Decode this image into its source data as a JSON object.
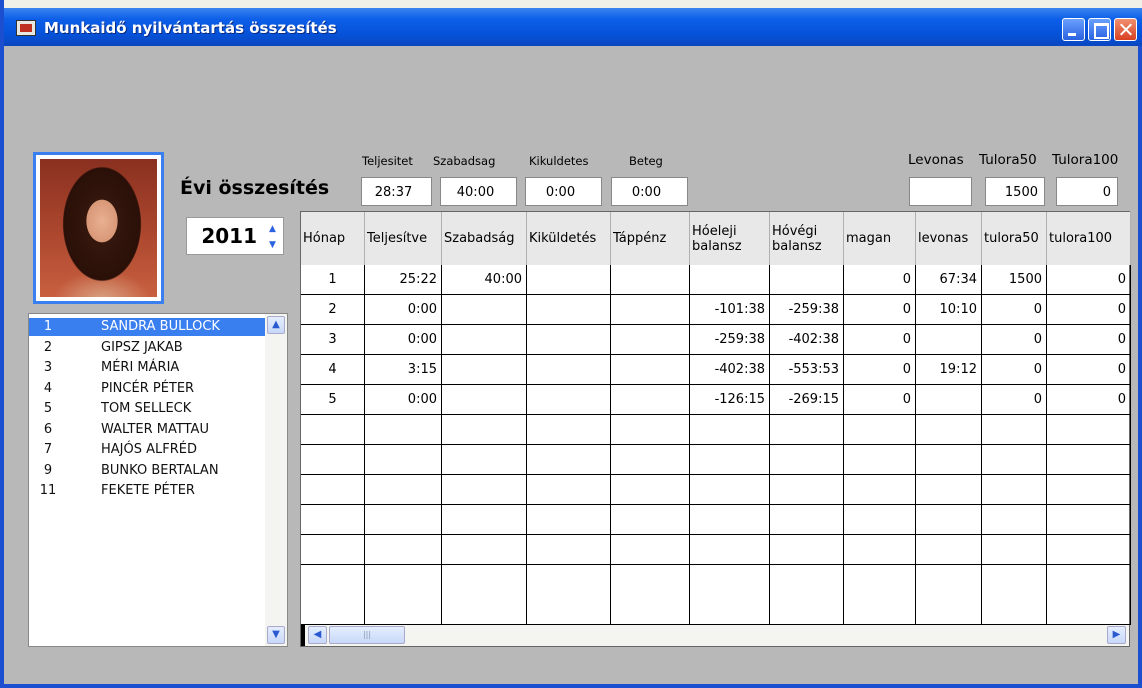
{
  "window": {
    "title": "Munkaidő nyilvántartás összesítés"
  },
  "summary": {
    "heading": "Évi összesítés",
    "year": "2011",
    "fields": [
      {
        "label": "Teljesitet",
        "value": "28:37"
      },
      {
        "label": "Szabadsag",
        "value": "40:00"
      },
      {
        "label": "Kikuldetes",
        "value": "0:00"
      },
      {
        "label": "Beteg",
        "value": "0:00"
      },
      {
        "label": "Levonas",
        "value": ""
      },
      {
        "label": "Tulora50",
        "value": "1500"
      },
      {
        "label": "Tulora100",
        "value": "0"
      }
    ]
  },
  "employees": [
    {
      "num": "1",
      "name": "SANDRA BULLOCK",
      "selected": true
    },
    {
      "num": "2",
      "name": "GIPSZ JAKAB"
    },
    {
      "num": "3",
      "name": "MÉRI MÁRIA"
    },
    {
      "num": "4",
      "name": "PINCÉR PÉTER"
    },
    {
      "num": "5",
      "name": "TOM SELLECK"
    },
    {
      "num": "6",
      "name": "WALTER MATTAU"
    },
    {
      "num": "7",
      "name": "HAJÓS ALFRÉD"
    },
    {
      "num": "9",
      "name": "BUNKO BERTALAN"
    },
    {
      "num": "11",
      "name": "FEKETE PÉTER"
    }
  ],
  "table": {
    "columns": [
      "Hónap",
      "Teljesítve",
      "Szabadság",
      "Kiküldetés",
      "Táppénz",
      "Hóeleji balansz",
      "Hóvégi balansz",
      "magan",
      "levonas",
      "tulora50",
      "tulora100"
    ],
    "rows": [
      [
        "1",
        "25:22",
        "40:00",
        "",
        "",
        "",
        "",
        "0",
        "67:34",
        "1500",
        "0"
      ],
      [
        "2",
        "0:00",
        "",
        "",
        "",
        "-101:38",
        "-259:38",
        "0",
        "10:10",
        "0",
        "0"
      ],
      [
        "3",
        "0:00",
        "",
        "",
        "",
        "-259:38",
        "-402:38",
        "0",
        "",
        "0",
        "0"
      ],
      [
        "4",
        "3:15",
        "",
        "",
        "",
        "-402:38",
        "-553:53",
        "0",
        "19:12",
        "0",
        "0"
      ],
      [
        "5",
        "0:00",
        "",
        "",
        "",
        "-126:15",
        "-269:15",
        "0",
        "",
        "0",
        "0"
      ]
    ],
    "empty_rows": 6
  },
  "colors": {
    "titlebar": "#0552d8",
    "selection": "#3a7ff0",
    "window_bg": "#b8b8b8"
  },
  "icons": {
    "app": "app-icon",
    "minimize": "minimize-icon",
    "maximize": "maximize-icon",
    "close": "close-icon",
    "spin_up": "chevron-up-icon",
    "spin_down": "chevron-down-icon",
    "scroll_up": "scroll-up-icon",
    "scroll_down": "scroll-down-icon",
    "scroll_left": "scroll-left-icon",
    "scroll_right": "scroll-right-icon"
  }
}
